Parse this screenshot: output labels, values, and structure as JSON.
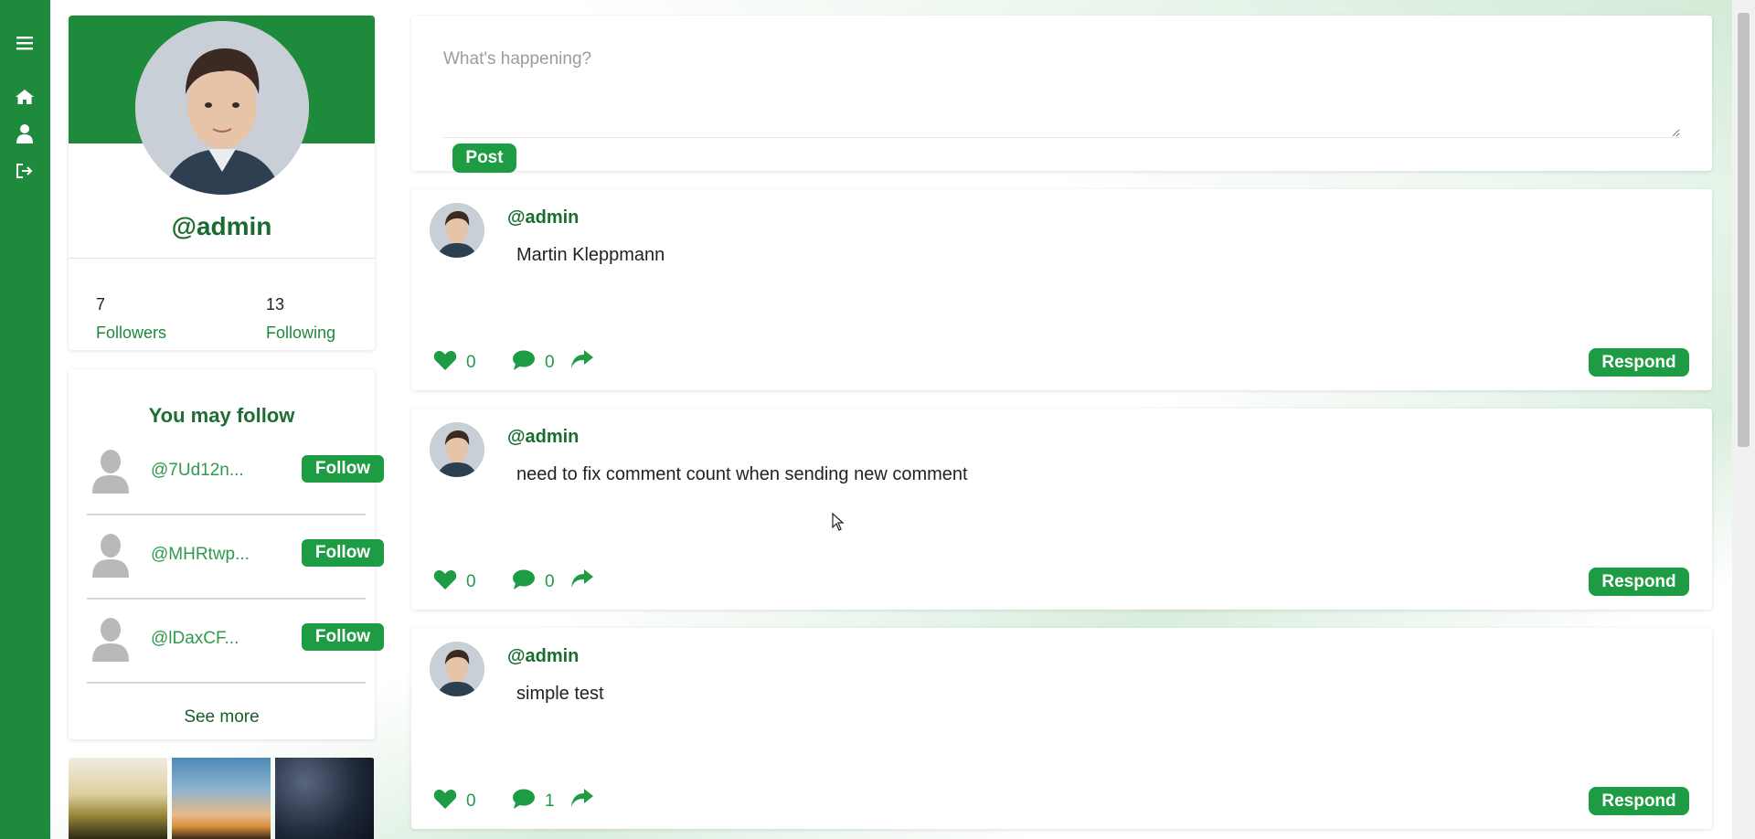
{
  "nav": {
    "icons": [
      "menu-icon",
      "home-icon",
      "user-icon",
      "logout-icon"
    ]
  },
  "profile": {
    "handle": "@admin",
    "followers_count": "7",
    "followers_label": "Followers",
    "following_count": "13",
    "following_label": "Following"
  },
  "suggestions": {
    "title": "You may follow",
    "items": [
      {
        "handle": "@7Ud12n...",
        "button": "Follow"
      },
      {
        "handle": "@MHRtwp...",
        "button": "Follow"
      },
      {
        "handle": "@lDaxCF...",
        "button": "Follow"
      }
    ],
    "see_more": "See more"
  },
  "composer": {
    "placeholder": "What's happening?",
    "post_label": "Post"
  },
  "posts": [
    {
      "handle": "@admin",
      "text": "Martin Kleppmann",
      "likes": "0",
      "comments": "0",
      "respond": "Respond"
    },
    {
      "handle": "@admin",
      "text": "need to fix comment count when sending new comment",
      "likes": "0",
      "comments": "0",
      "respond": "Respond"
    },
    {
      "handle": "@admin",
      "text": "simple test",
      "likes": "0",
      "comments": "1",
      "respond": "Respond"
    }
  ],
  "colors": {
    "brand": "#1e8a3c",
    "button": "#1e9c44",
    "handle": "#1a6b30"
  }
}
